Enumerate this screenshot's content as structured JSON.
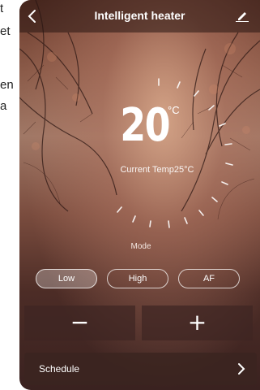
{
  "left_text": [
    "t",
    "et",
    "en",
    "a"
  ],
  "header": {
    "title": "Intelligent heater",
    "back_icon": "chevron-left-icon",
    "edit_icon": "pencil-icon"
  },
  "temperature": {
    "value": "20",
    "unit": "°C",
    "current_label": "Current Temp25°C"
  },
  "mode": {
    "label": "Mode",
    "options": [
      "Low",
      "High",
      "AF"
    ],
    "selected": "Low"
  },
  "controls": {
    "minus": "−",
    "plus": "+"
  },
  "schedule": {
    "label": "Schedule"
  },
  "colors": {
    "text": "#ffffff",
    "background_dark": "#3a2220",
    "selected_mode_fill": "rgba(255,255,255,0.28)"
  }
}
